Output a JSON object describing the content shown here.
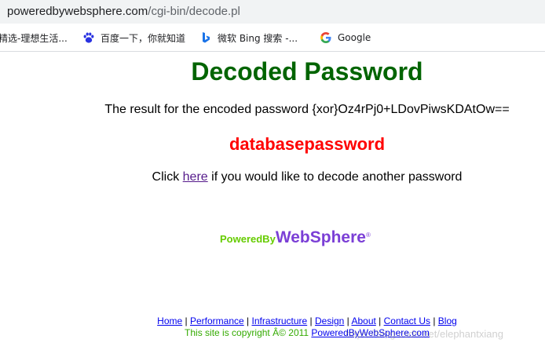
{
  "browser": {
    "url_host": "poweredbywebsphere.com",
    "url_path": "/cgi-bin/decode.pl",
    "bookmarks": [
      {
        "label": "精选-理想生活...",
        "icon": "bookmark-icon"
      },
      {
        "label": "百度一下，你就知道",
        "icon": "baidu-paw-icon"
      },
      {
        "label": "微软 Bing 搜索 -...",
        "icon": "bing-icon"
      },
      {
        "label": "Google",
        "icon": "google-icon"
      }
    ]
  },
  "page": {
    "title": "Decoded Password",
    "result_prefix": "The result for the encoded password ",
    "encoded_password": "{xor}Oz4rPj0+LDovPiwsKDAtOw==",
    "decoded_password": "databasepassword",
    "click_prefix": "Click ",
    "click_link": "here",
    "click_suffix": " if you would like to decode another password"
  },
  "logo": {
    "powered_by": "PoweredBy",
    "websphere": "WebSphere",
    "registered": "®",
    "colors": {
      "powered_by": "#66cc00",
      "websphere": "#7b3fd6"
    }
  },
  "footer": {
    "links": [
      "Home",
      "Performance",
      "Infrastructure",
      "Design",
      "About",
      "Contact Us",
      "Blog"
    ],
    "separator": " | ",
    "copyright_prefix": "This site is copyright Â© 2011 ",
    "copyright_link": "PoweredByWebSphere.com"
  },
  "watermark": "https://blog.csdn.net/elephantxiang",
  "colors": {
    "title": "#006400",
    "decoded": "#ff0000",
    "link": "#0000ee",
    "visited_link": "#551a8b"
  }
}
